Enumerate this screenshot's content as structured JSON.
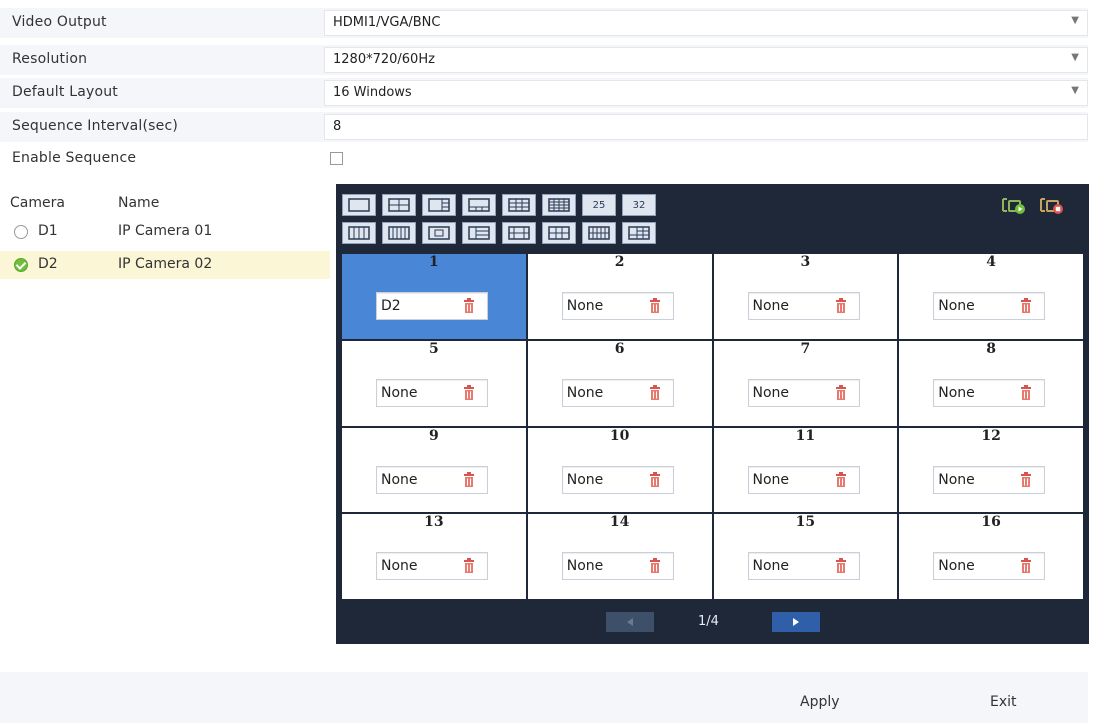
{
  "settings": {
    "video_output": {
      "label": "Video Output",
      "value": "HDMI1/VGA/BNC"
    },
    "resolution": {
      "label": "Resolution",
      "value": "1280*720/60Hz"
    },
    "default_layout": {
      "label": "Default Layout",
      "value": "16 Windows"
    },
    "sequence_interval": {
      "label": "Sequence Interval(sec)",
      "value": "8"
    },
    "enable_sequence": {
      "label": "Enable Sequence",
      "checked": false
    }
  },
  "camera_list": {
    "col_camera": "Camera",
    "col_name": "Name",
    "rows": [
      {
        "id": "D1",
        "name": "IP Camera 01",
        "selected": false
      },
      {
        "id": "D2",
        "name": "IP Camera 02",
        "selected": true
      }
    ]
  },
  "layout_toolbar": {
    "row1": [
      "1",
      "4",
      "6",
      "8",
      "9",
      "13",
      "25",
      "32"
    ],
    "row1_labels": {
      "25": "25",
      "32": "32"
    },
    "row2_count": 8
  },
  "grid": {
    "active_window": 1,
    "windows": [
      {
        "num": "1",
        "camera": "D2"
      },
      {
        "num": "2",
        "camera": "None"
      },
      {
        "num": "3",
        "camera": "None"
      },
      {
        "num": "4",
        "camera": "None"
      },
      {
        "num": "5",
        "camera": "None"
      },
      {
        "num": "6",
        "camera": "None"
      },
      {
        "num": "7",
        "camera": "None"
      },
      {
        "num": "8",
        "camera": "None"
      },
      {
        "num": "9",
        "camera": "None"
      },
      {
        "num": "10",
        "camera": "None"
      },
      {
        "num": "11",
        "camera": "None"
      },
      {
        "num": "12",
        "camera": "None"
      },
      {
        "num": "13",
        "camera": "None"
      },
      {
        "num": "14",
        "camera": "None"
      },
      {
        "num": "15",
        "camera": "None"
      },
      {
        "num": "16",
        "camera": "None"
      }
    ]
  },
  "pager": {
    "text": "1/4"
  },
  "footer": {
    "apply": "Apply",
    "exit": "Exit"
  },
  "colors": {
    "accent": "#4a86d6",
    "panel_bg": "#1e2838",
    "selected_row": "#fbf7d6",
    "trash": "#d9534f",
    "check": "#6fbf3c"
  }
}
